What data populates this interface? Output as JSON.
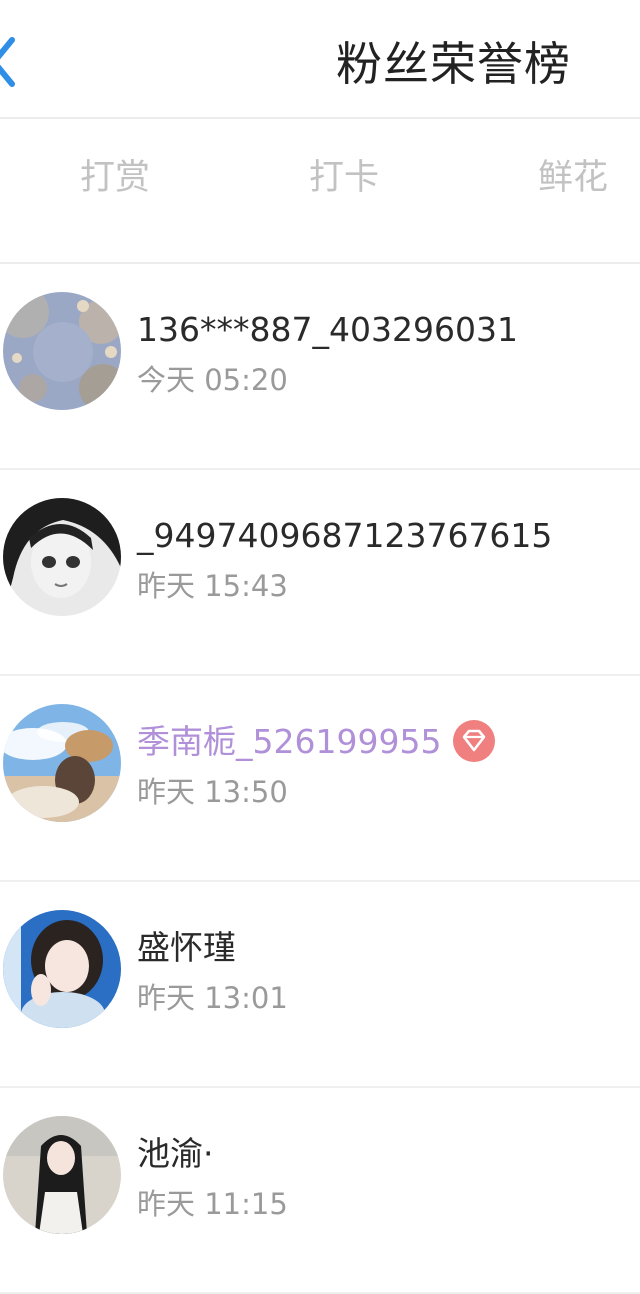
{
  "header": {
    "title": "粉丝荣誉榜",
    "back_icon": "chevron-left-icon",
    "accent_color": "#2f8fe6"
  },
  "tabs": [
    {
      "label": "打赏"
    },
    {
      "label": "打卡"
    },
    {
      "label": "鲜花"
    }
  ],
  "fans": [
    {
      "name": "136***887_403296031",
      "time": "今天 05:20",
      "vip": false
    },
    {
      "name": "_9497409687123767615",
      "time": "昨天 15:43",
      "vip": false
    },
    {
      "name": "季南栀_526199955",
      "time": "昨天 13:50",
      "vip": true,
      "badge_icon": "diamond-badge-icon",
      "name_color": "#b090d8"
    },
    {
      "name": "盛怀瑾",
      "time": "昨天 13:01",
      "vip": false
    },
    {
      "name": "池渝·",
      "time": "昨天 11:15",
      "vip": false
    }
  ]
}
